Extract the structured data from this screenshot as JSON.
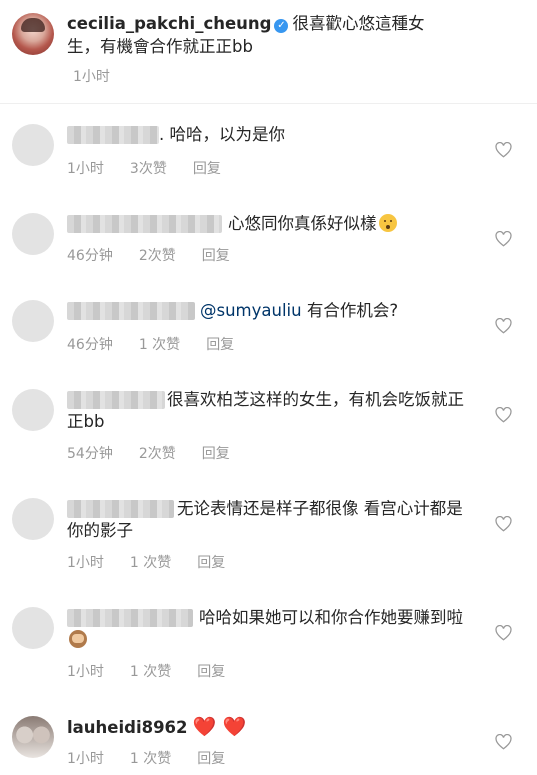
{
  "post": {
    "username": "cecilia_pakchi_cheung",
    "caption": "很喜歡心悠這種女生，有機會合作就正正bb",
    "time": "1小时"
  },
  "comments": [
    {
      "text": ". 哈哈，以为是你",
      "time": "1小时",
      "likes": "3次赞",
      "reply": "回复"
    },
    {
      "text": "心悠同你真係好似樣",
      "time": "46分钟",
      "likes": "2次赞",
      "reply": "回复"
    },
    {
      "mention": "@sumyauliu",
      "text": " 有合作机会?",
      "time": "46分钟",
      "likes": "1 次赞",
      "reply": "回复"
    },
    {
      "text": "很喜欢柏芝这样的女生，有机会吃饭就正正bb",
      "time": "54分钟",
      "likes": "2次赞",
      "reply": "回复"
    },
    {
      "text": "无论表情还是样子都很像 看宫心计都是你的影子",
      "time": "1小时",
      "likes": "1 次赞",
      "reply": "回复"
    },
    {
      "text": "哈哈如果她可以和你合作她要赚到啦",
      "time": "1小时",
      "likes": "1 次赞",
      "reply": "回复"
    },
    {
      "username": "lauheidi8962",
      "text": "❤️ ❤️",
      "time": "1小时",
      "likes": "1 次赞",
      "reply": "回复"
    }
  ],
  "icons": {
    "verified": "verified-badge-icon",
    "like": "heart-outline-icon",
    "accent": "#3897f0"
  }
}
